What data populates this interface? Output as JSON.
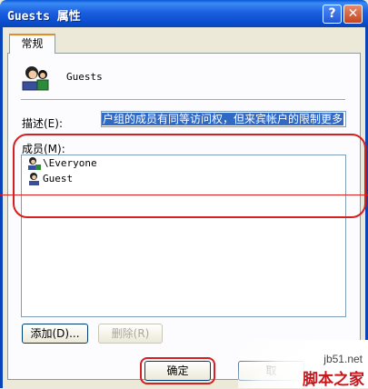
{
  "window": {
    "title": "Guests 属性",
    "help": "?",
    "close": "✕"
  },
  "tabs": [
    {
      "label": "常规"
    }
  ],
  "group": {
    "name": "Guests"
  },
  "description": {
    "label": "描述(E):",
    "value": "户组的成员有同等访问权，但来宾帐户的限制更多"
  },
  "members": {
    "label": "成员(M):",
    "items": [
      {
        "name": "\\Everyone"
      },
      {
        "name": "Guest"
      }
    ]
  },
  "buttons": {
    "add": "添加(D)...",
    "remove": "删除(R)",
    "ok": "确定",
    "cancel": "取"
  },
  "watermark": {
    "site": "jb51.net",
    "brand": "脚本之家"
  },
  "colors": {
    "titlebar": "#0a4fd0",
    "selection": "#316ac5",
    "annotation": "#d42020"
  }
}
